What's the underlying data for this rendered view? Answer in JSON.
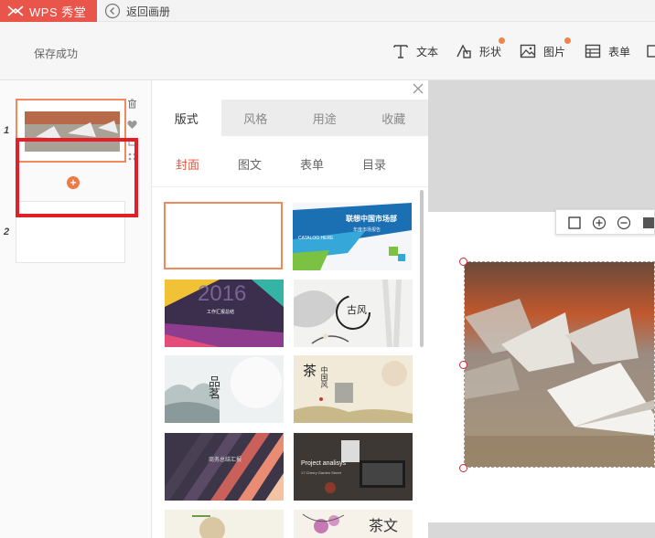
{
  "topbar": {
    "brand": "WPS 秀堂",
    "back_label": "返回画册"
  },
  "toolbar": {
    "save_status": "保存成功",
    "tools": [
      {
        "label": "文本",
        "icon": "text-icon"
      },
      {
        "label": "形状",
        "icon": "shape-icon",
        "badge": true
      },
      {
        "label": "图片",
        "icon": "image-icon",
        "badge": true
      },
      {
        "label": "表单",
        "icon": "form-icon"
      }
    ]
  },
  "slides": [
    {
      "number": "1"
    },
    {
      "number": "2"
    }
  ],
  "add_slide_icon": "plus-circle-icon",
  "template_panel": {
    "tabs": [
      {
        "label": "版式",
        "active": true
      },
      {
        "label": "风格",
        "active": false
      },
      {
        "label": "用途",
        "active": false
      },
      {
        "label": "收藏",
        "active": false
      }
    ],
    "sub_tabs": [
      {
        "label": "封面",
        "active": true
      },
      {
        "label": "图文",
        "active": false
      },
      {
        "label": "表单",
        "active": false
      },
      {
        "label": "目录",
        "active": false
      }
    ],
    "cards": [
      {
        "name": "template-blank"
      },
      {
        "name": "template-catalog",
        "title": "联想中国市场部",
        "line1": "CATALOG HERE",
        "line2": "年度市场报告"
      },
      {
        "name": "template-2016",
        "big": "2016",
        "line1": "工作汇报总结"
      },
      {
        "name": "template-gufeng",
        "title": "古风"
      },
      {
        "name": "template-pinming",
        "title": "品茗"
      },
      {
        "name": "template-chinese-wind",
        "title": "茶",
        "line1": "中国风"
      },
      {
        "name": "template-stripes",
        "line1": "商务总结汇报"
      },
      {
        "name": "template-project",
        "title": "Project analisys",
        "line1": "17 Cherry Garden Street"
      },
      {
        "name": "template-landscape"
      },
      {
        "name": "template-tea",
        "title": "茶文"
      }
    ]
  },
  "colors": {
    "brand": "#e9554a",
    "accent": "#e8553f",
    "highlight_box": "#e21f26",
    "badge": "#f0824a"
  }
}
